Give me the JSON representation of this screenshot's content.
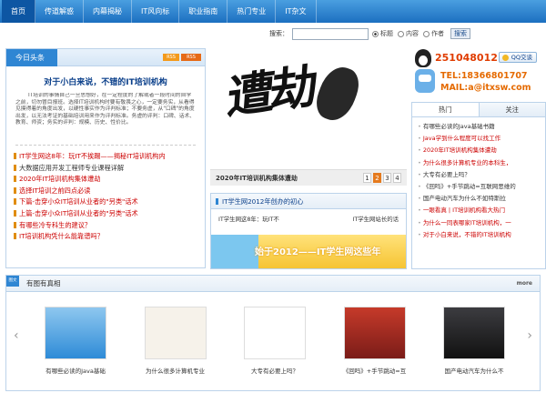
{
  "nav": {
    "items": [
      "首页",
      "传道解惑",
      "内幕揭秘",
      "IT风向标",
      "职业指南",
      "热门专业",
      "IT杂文"
    ],
    "active_index": 0,
    "accent": "#1c6fc0"
  },
  "search": {
    "label": "搜索：",
    "value": "",
    "options": [
      "标题",
      "内容",
      "作者"
    ],
    "selected": "标题",
    "button": "搜索"
  },
  "today": {
    "tab": "今日头条",
    "rss1": "RSS",
    "rss2": "RSS",
    "headline": "对于小白来说，不错的IT培训机构",
    "summary": "IT培训的事情自己一旦思想好，在一定程度的了解或者一段时间的自学之前，切勿冒目报班。选择IT培训机构时要有敬畏之心，一定要务实，从看得见摸得着的角度出发，以硬性事实作为评判标准；不要务虚，从\"口碑\"的角度出发，以无法考证的基础培训用来作为评判标准。务虚的评判：口碑、话术、教育、师资；务实的评判：规模、历史、性价比。",
    "list": [
      {
        "text": "IT学生网这8年：玩IT不挨踢——揭秘IT培训机构内",
        "style": "red"
      },
      {
        "text": "大数据应用开发工程师专业课程详解",
        "style": "blk"
      },
      {
        "text": "2020年IT培训机构集体遭劫",
        "style": "red"
      },
      {
        "text": "选择IT培训之前四点必读",
        "style": "red"
      },
      {
        "text": "下篇-击穿小众IT培训从业者的\"另类\"话术",
        "style": "red"
      },
      {
        "text": "上篇-击穿小众IT培训从业者的\"另类\"话术",
        "style": "red"
      },
      {
        "text": "有哪些冷专科生的建议？",
        "style": "red"
      },
      {
        "text": "IT培训机构凭什么能靠谱吗？",
        "style": "red"
      }
    ]
  },
  "slider": {
    "caption": "2020年IT培训机构集体遭劫",
    "calligraphy": "遭劫",
    "pages": [
      "1",
      "2",
      "3",
      "4"
    ],
    "active_page": "2"
  },
  "center": {
    "title": "IT学生网2012年创办的初心",
    "link1": "IT学生网这8年：玩IT不",
    "link2": "IT学生网站长的话",
    "banner": "始于2012——IT学生网这些年"
  },
  "contact": {
    "qq": "251048012",
    "qq_button": "QQ交谈",
    "tel": "TEL:18366801707",
    "mail": "MAIL:a@itxsw.com"
  },
  "right": {
    "tabs": [
      "热门",
      "关注"
    ],
    "active_tab": "热门",
    "list": [
      {
        "text": "有哪些必读的Java基础书籍",
        "style": "blk"
      },
      {
        "text": "Java学到什么程度可以找工作",
        "style": "red"
      },
      {
        "text": "2020年IT培训机构集体遭劫",
        "style": "red"
      },
      {
        "text": "为什么很多计算机专业的本科生，",
        "style": "red"
      },
      {
        "text": "大专有必要上吗？",
        "style": "blk"
      },
      {
        "text": "《回吗》+手节跳动=互联网思维的",
        "style": "blk"
      },
      {
        "text": "国产电动汽车为什么不如特斯拉",
        "style": "blk"
      },
      {
        "text": "一眼看真 | IT培训机构看大热门",
        "style": "red"
      },
      {
        "text": "为什么一同表哪家IT培训机构，一",
        "style": "red"
      },
      {
        "text": "对于小白来说，不错的IT培训机构",
        "style": "red"
      }
    ]
  },
  "gallery": {
    "badge": "图文",
    "title": "有图有真相",
    "more": "more",
    "items": [
      {
        "caption": "有哪些必读的Java基础"
      },
      {
        "caption": "为什么很多计算机专业"
      },
      {
        "caption": "大专有必要上吗？"
      },
      {
        "caption": "《回吗》+手节跳动=互"
      },
      {
        "caption": "国产电动汽车为什么不"
      }
    ]
  }
}
